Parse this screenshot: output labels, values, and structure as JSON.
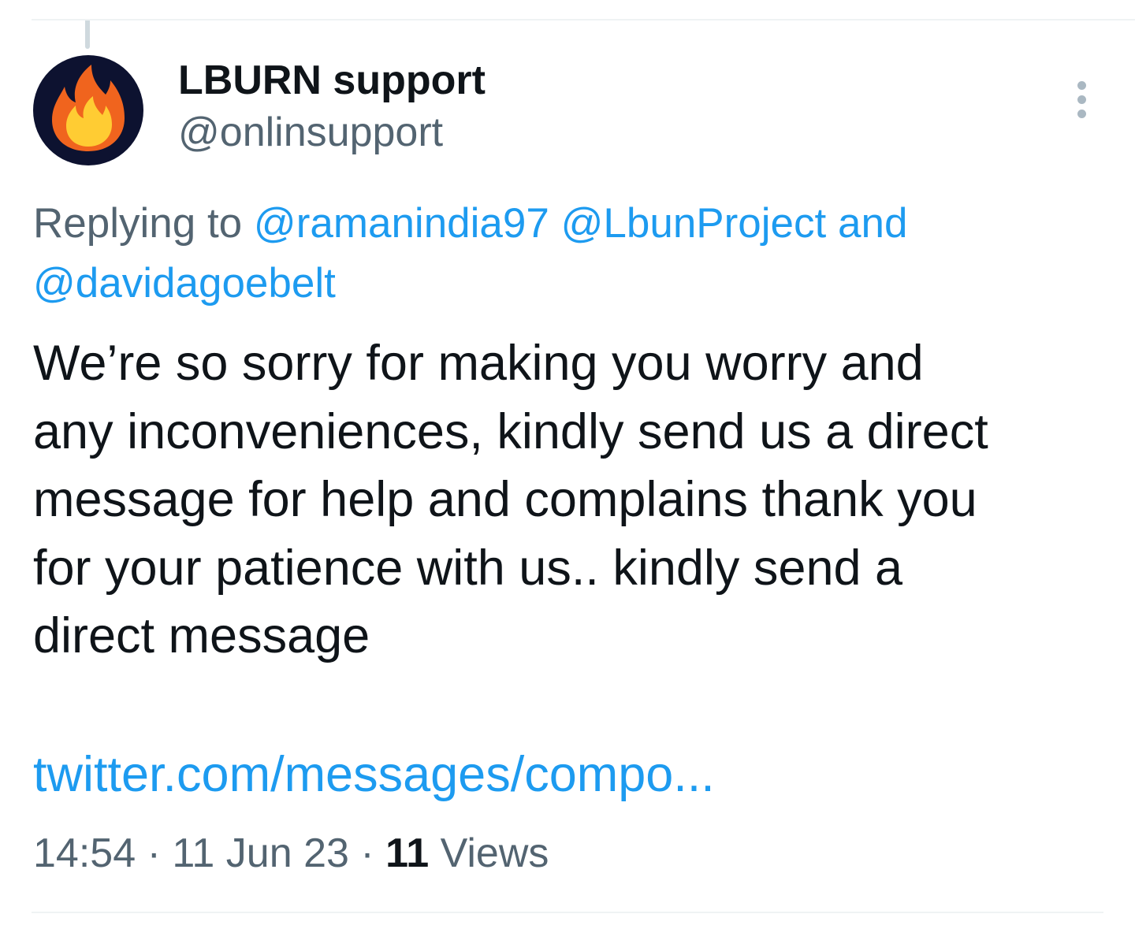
{
  "tweet": {
    "display_name": "LBURN support",
    "handle": "@onlinsupport",
    "avatar_icon": "fire-icon",
    "more_icon": "more-vertical-icon",
    "reply": {
      "prefix": "Replying to",
      "mentions": [
        "@ramanindia97",
        "@LbunProject"
      ],
      "joiner": "and",
      "last_mention": "@davidagoebelt"
    },
    "body_lines": [
      "We’re so sorry for making you worry and",
      "any inconveniences, kindly send us a direct",
      "message for help and complains thank you",
      "for your patience with us.. kindly send a",
      "direct message"
    ],
    "link": "twitter.com/messages/compo...",
    "time": "14:54",
    "separator": "·",
    "date": "11 Jun 23",
    "views_count": "11",
    "views_label": "Views"
  },
  "colors": {
    "text_primary": "#0f1419",
    "text_secondary": "#536471",
    "accent": "#1d9bf0",
    "divider": "#eff3f4",
    "avatar_bg": "#0d1230",
    "flame_outer": "#f0641e",
    "flame_inner": "#ffcc33"
  }
}
